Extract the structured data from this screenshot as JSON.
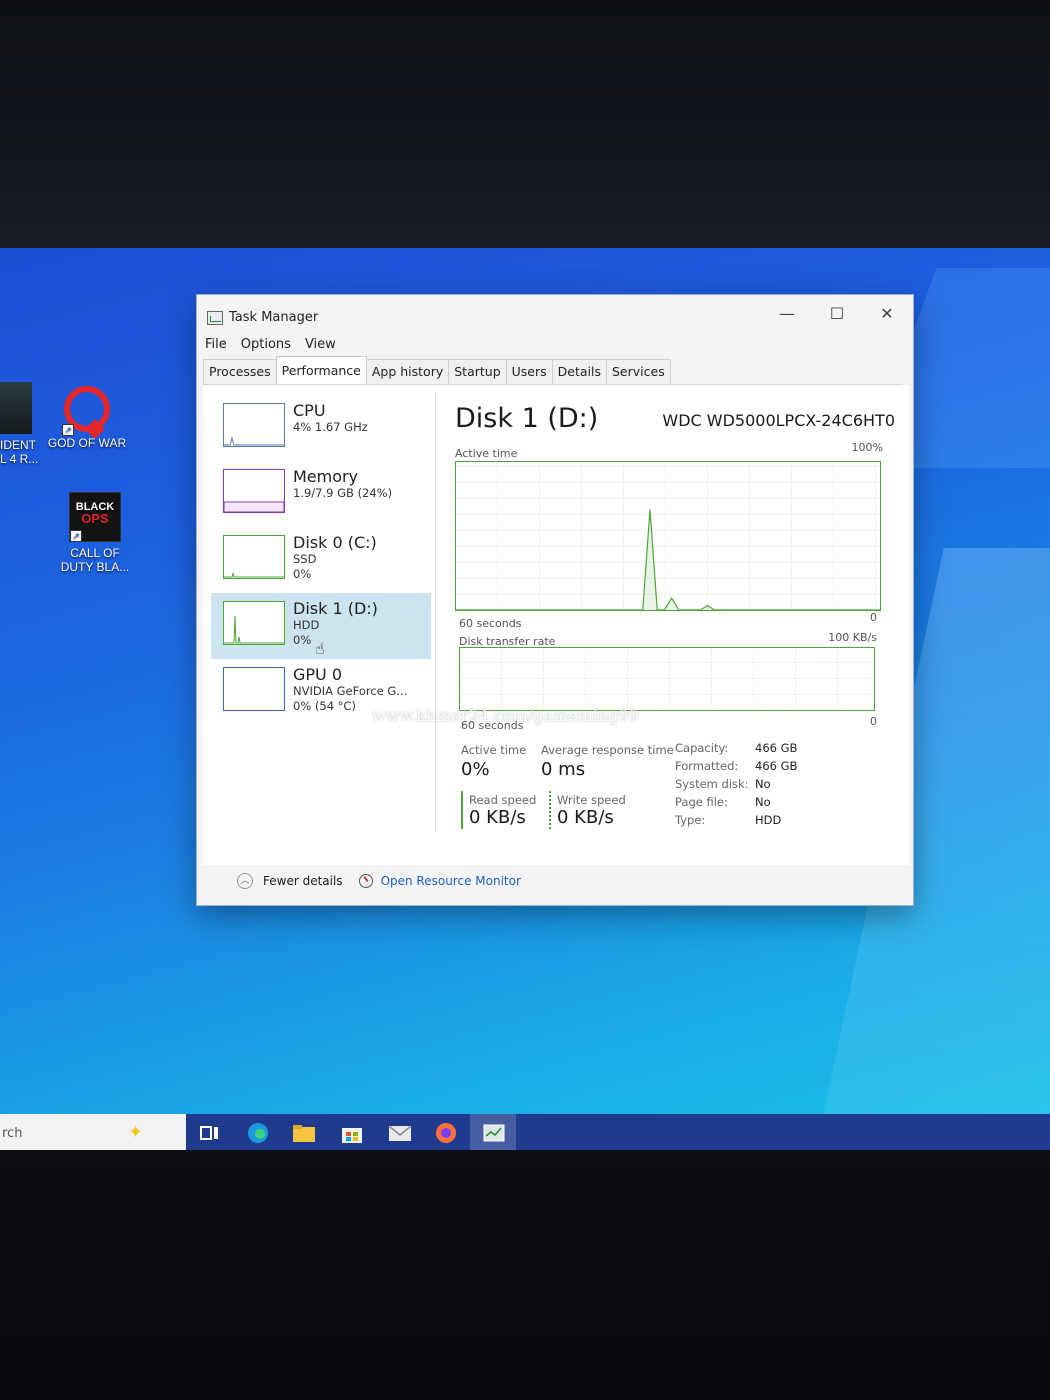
{
  "desktop": {
    "icons": [
      {
        "label_line1": "IDENT",
        "label_line2": "L 4 R...",
        "icon": "resident-evil-icon"
      },
      {
        "label_line1": "GOD OF WAR",
        "label_line2": "",
        "icon": "god-of-war-icon"
      },
      {
        "label_line1": "CALL OF",
        "label_line2": "DUTY BLA...",
        "icon": "call-of-duty-icon",
        "art_top": "BLACK",
        "art_bottom": "OPS"
      }
    ]
  },
  "window": {
    "title": "Task Manager",
    "controls": {
      "minimize": "—",
      "maximize": "☐",
      "close": "✕"
    },
    "menu": [
      "File",
      "Options",
      "View"
    ],
    "tabs": [
      "Processes",
      "Performance",
      "App history",
      "Startup",
      "Users",
      "Details",
      "Services"
    ],
    "active_tab": "Performance"
  },
  "sidebar": [
    {
      "name": "CPU",
      "line1": "4%  1.67 GHz",
      "line2": "",
      "line3": ""
    },
    {
      "name": "Memory",
      "line1": "1.9/7.9 GB (24%)",
      "line2": "",
      "line3": ""
    },
    {
      "name": "Disk 0 (C:)",
      "line1": "SSD",
      "line2": "0%",
      "line3": ""
    },
    {
      "name": "Disk 1 (D:)",
      "line1": "HDD",
      "line2": "0%",
      "line3": ""
    },
    {
      "name": "GPU 0",
      "line1": "NVIDIA GeForce G...",
      "line2": "0%  (54 °C)",
      "line3": ""
    }
  ],
  "selected_item": "Disk 1 (D:)",
  "detail": {
    "title": "Disk 1 (D:)",
    "model": "WDC WD5000LPCX-24C6HT0",
    "graph1": {
      "label": "Active time",
      "max": "100%",
      "min": "0",
      "span": "60 seconds",
      "values": [
        0,
        0,
        0,
        0,
        0,
        0,
        0,
        0,
        0,
        0,
        0,
        0,
        0,
        0,
        0,
        0,
        0,
        0,
        0,
        0,
        0,
        0,
        0,
        0,
        0,
        0,
        0,
        68,
        0,
        0,
        8,
        0,
        0,
        0,
        0,
        3,
        0,
        0,
        0,
        0,
        0,
        0,
        0,
        0,
        0,
        0,
        0,
        0,
        0,
        0,
        0,
        0,
        0,
        0,
        0,
        0,
        0,
        0,
        0,
        0
      ]
    },
    "graph2": {
      "label": "Disk transfer rate",
      "max": "100 KB/s",
      "min": "0",
      "span": "60 seconds"
    },
    "stats": {
      "active_time_label": "Active time",
      "active_time": "0%",
      "response_label": "Average response time",
      "response": "0 ms",
      "read_label": "Read speed",
      "read": "0 KB/s",
      "write_label": "Write speed",
      "write": "0 KB/s"
    },
    "props": [
      {
        "label": "Capacity:",
        "value": "466 GB"
      },
      {
        "label": "Formatted:",
        "value": "466 GB"
      },
      {
        "label": "System disk:",
        "value": "No"
      },
      {
        "label": "Page file:",
        "value": "No"
      },
      {
        "label": "Type:",
        "value": "HDD"
      }
    ]
  },
  "footer": {
    "fewer": "Fewer details",
    "resmon": "Open Resource Monitor"
  },
  "watermark": "www.khmer24.com/gameming99",
  "taskbar": {
    "search_text": "rch",
    "icons": [
      "task-view-icon",
      "edge-icon",
      "file-explorer-icon",
      "store-icon",
      "mail-icon",
      "firefox-icon",
      "task-manager-icon"
    ]
  },
  "colors": {
    "disk_green": "#4da53a",
    "cpu_blue": "#5a7aa8",
    "memory_purple": "#8b3ba8",
    "selected_bg": "#cce4f0",
    "link": "#1a5fc4"
  }
}
